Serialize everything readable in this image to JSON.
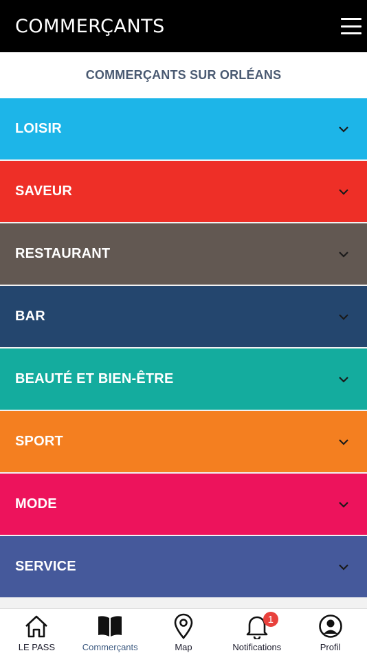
{
  "header": {
    "title": "COMMERÇANTS",
    "menu_icon": "hamburger-menu-icon"
  },
  "subheader": {
    "title": "COMMERÇANTS SUR ORLÉANS"
  },
  "categories": [
    {
      "label": "LOISIR",
      "color": "#1db5e8"
    },
    {
      "label": "SAVEUR",
      "color": "#ee2f27"
    },
    {
      "label": "RESTAURANT",
      "color": "#625852"
    },
    {
      "label": "BAR",
      "color": "#24466e"
    },
    {
      "label": "BEAUTÉ ET BIEN-ÊTRE",
      "color": "#14ac9e"
    },
    {
      "label": "SPORT",
      "color": "#f47f20"
    },
    {
      "label": "MODE",
      "color": "#ed135c"
    },
    {
      "label": "SERVICE",
      "color": "#45599b"
    }
  ],
  "tabs": [
    {
      "label": "LE PASS",
      "icon": "home-icon"
    },
    {
      "label": "Commerçants",
      "icon": "book-icon",
      "active": true
    },
    {
      "label": "Map",
      "icon": "map-pin-icon"
    },
    {
      "label": "Notifications",
      "icon": "bell-icon",
      "badge": "1"
    },
    {
      "label": "Profil",
      "icon": "profile-icon"
    }
  ]
}
